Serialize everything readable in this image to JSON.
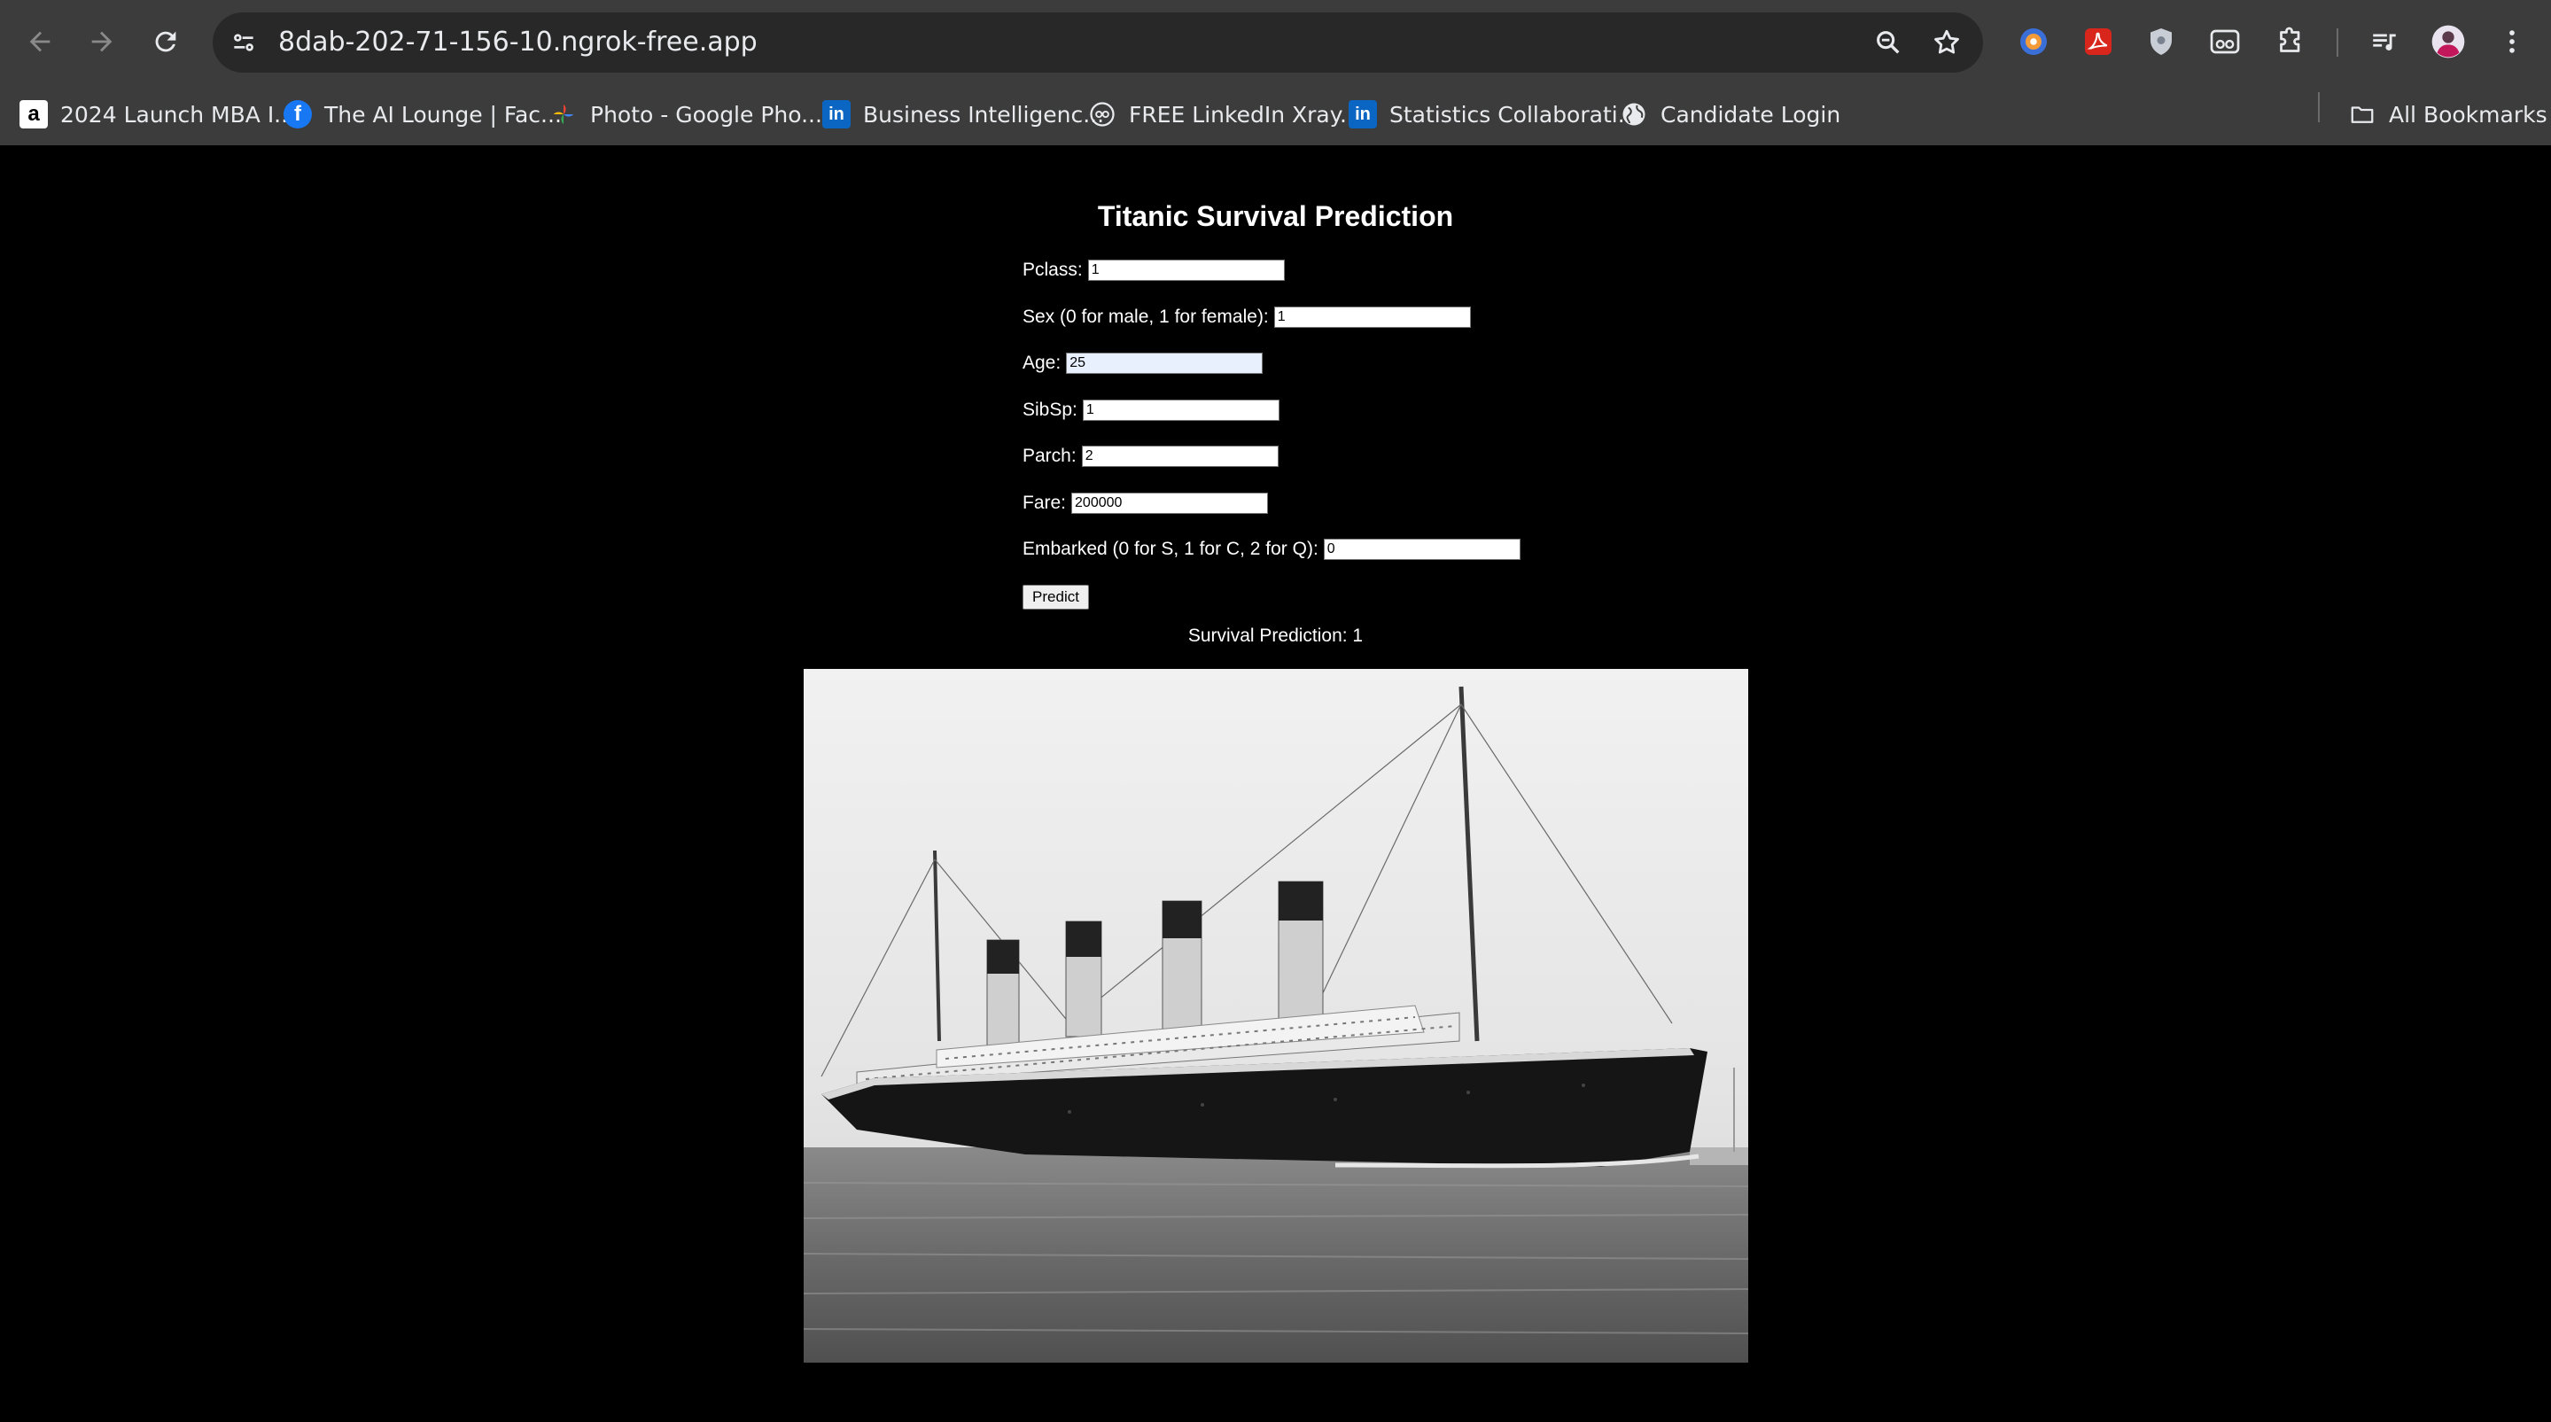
{
  "browser": {
    "url": "8dab-202-71-156-10.ngrok-free.app",
    "bookmarks": [
      {
        "label": "2024 Launch MBA I...",
        "icon": "amazon-icon"
      },
      {
        "label": "The AI Lounge | Fac...",
        "icon": "facebook-icon"
      },
      {
        "label": "Photo - Google Pho...",
        "icon": "google-photos-icon"
      },
      {
        "label": "Business Intelligenc...",
        "icon": "linkedin-icon"
      },
      {
        "label": "FREE LinkedIn Xray...",
        "icon": "xray-icon"
      },
      {
        "label": "Statistics Collaborati...",
        "icon": "linkedin-icon"
      },
      {
        "label": "Candidate Login",
        "icon": "globe-icon"
      }
    ],
    "all_bookmarks_label": "All Bookmarks"
  },
  "page": {
    "title": "Titanic Survival Prediction",
    "fields": {
      "pclass": {
        "label": "Pclass:",
        "value": "1"
      },
      "sex": {
        "label": "Sex (0 for male, 1 for female):",
        "value": "1"
      },
      "age": {
        "label": "Age:",
        "value": "25"
      },
      "sibsp": {
        "label": "SibSp:",
        "value": "1"
      },
      "parch": {
        "label": "Parch:",
        "value": "2"
      },
      "fare": {
        "label": "Fare:",
        "value": "200000"
      },
      "embarked": {
        "label": "Embarked (0 for S, 1 for C, 2 for Q):",
        "value": "0"
      }
    },
    "predict_label": "Predict",
    "result_text": "Survival Prediction: 1"
  },
  "colors": {
    "chrome_bg": "#3c3c3c",
    "omnibox_bg": "#282828",
    "page_bg": "#000000",
    "page_text": "#ffffff"
  }
}
